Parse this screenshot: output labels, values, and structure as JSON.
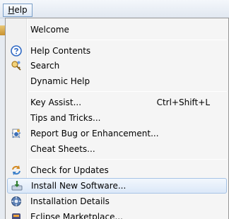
{
  "menubar": {
    "help_label_first": "H",
    "help_label_rest": "elp"
  },
  "menu": {
    "welcome": "Welcome",
    "help_contents": "Help Contents",
    "search": "Search",
    "dynamic_help": "Dynamic Help",
    "key_assist": "Key Assist...",
    "key_assist_shortcut": "Ctrl+Shift+L",
    "tips_and_tricks": "Tips and Tricks...",
    "report_bug": "Report Bug or Enhancement...",
    "cheat_sheets": "Cheat Sheets...",
    "check_for_updates": "Check for Updates",
    "install_new_software": "Install New Software...",
    "installation_details": "Installation Details",
    "eclipse_marketplace": "Eclipse Marketplace..."
  },
  "icons": {
    "help_contents": "question-circle-icon",
    "search": "search-key-icon",
    "report_bug": "bug-report-icon",
    "check_for_updates": "update-arrows-icon",
    "install_new_software": "install-software-icon",
    "installation_details": "installation-details-icon",
    "eclipse_marketplace": "marketplace-icon"
  },
  "colors": {
    "highlight_border": "#a7c4e6",
    "highlight_fill": "#dbe8f8",
    "help_icon_blue": "#2f69c4"
  }
}
